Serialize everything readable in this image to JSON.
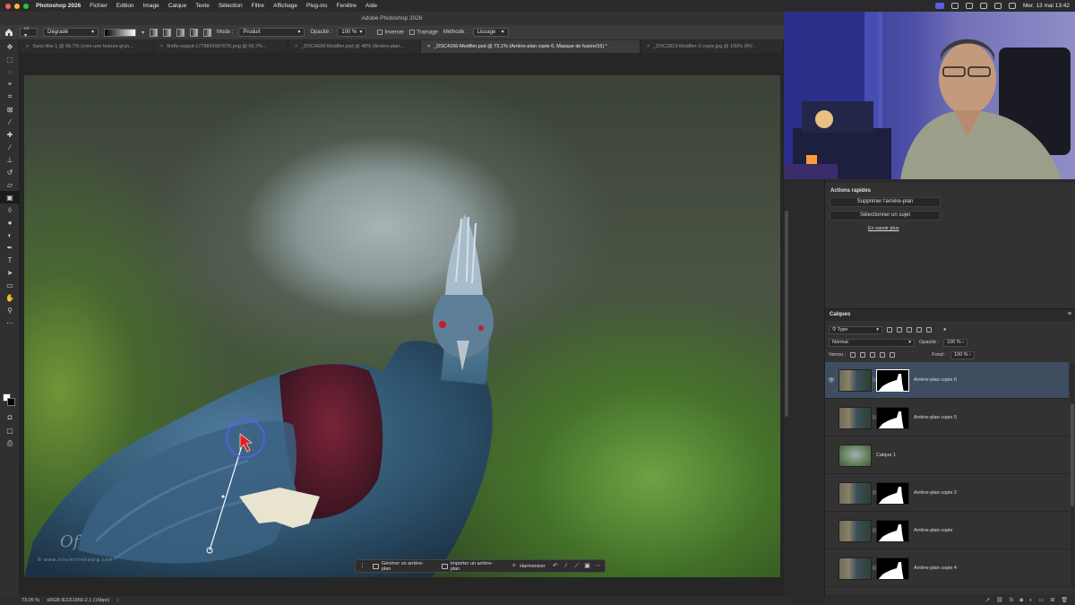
{
  "menubar": {
    "app": "Photoshop 2026",
    "items": [
      "Fichier",
      "Edition",
      "Image",
      "Calque",
      "Texte",
      "Sélection",
      "Filtre",
      "Affichage",
      "Plug-ins",
      "Fenêtre",
      "Aide"
    ],
    "datetime": "Mer. 13 mai 13:42"
  },
  "window_title": "Adobe Photoshop 2026",
  "options": {
    "preset": "Dégradé",
    "mode_label": "Mode :",
    "mode_value": "Produit",
    "opacity_label": "Opacité :",
    "opacity_value": "100 %",
    "invert": "Inverser",
    "dither": "Tramage",
    "method_label": "Méthode :",
    "method_value": "Lissage"
  },
  "tabs": [
    "Sans titre-1 @ 66,7% (crée une texture grun...",
    "firefly-output-1778664997676.png @ 66,7%...",
    "_DSC4690-Modifier.psd @ 48% (Arrière-plan...",
    "_DSC4166-Modifier.psd @ 73,1% (Arrière-plan copie 6, Masque de fusion/16) *",
    "_DSC2813-Modifier-2-copie.jpg @ 100% (RV..."
  ],
  "canvas": {
    "watermark": "© www.olivierfrebourg.com",
    "signature": "Of"
  },
  "contextual_bar": {
    "generate_bg": "Générer un arrière-plan",
    "import_bg": "Importer un arrière-plan",
    "harmonize": "Harmoniser"
  },
  "status": {
    "zoom": "73,05 %",
    "profile": "sRGB IEC61966-2.1 (16bpc)",
    "arrow": "›"
  },
  "quick_actions": {
    "title": "Actions rapides",
    "remove_bg": "Supprimer l'arrière-plan",
    "select_subject": "Sélectionner un sujet",
    "learn_more": "En savoir plus"
  },
  "layers_panel": {
    "title": "Calques",
    "filter": "Type",
    "blend_mode": "Normal",
    "opacity_label": "Opacité :",
    "opacity_value": "100 %",
    "lock_label": "Verrou :",
    "fill_label": "Fond :",
    "fill_value": "100 %",
    "layers": [
      {
        "name": "Arrière-plan copie 6",
        "selected": true,
        "visible": true,
        "mask": true
      },
      {
        "name": "Arrière-plan copie 5",
        "selected": false,
        "visible": false,
        "mask": true
      },
      {
        "name": "Calque 1",
        "selected": false,
        "visible": false,
        "mask": false
      },
      {
        "name": "Arrière-plan copie 2",
        "selected": false,
        "visible": false,
        "mask": true
      },
      {
        "name": "Arrière-plan copie",
        "selected": false,
        "visible": false,
        "mask": true
      },
      {
        "name": "Arrière-plan copie 4",
        "selected": false,
        "visible": false,
        "mask": true
      }
    ]
  },
  "colors": {
    "menubar": "#2a2a2c",
    "panel": "#323232",
    "selected_layer": "#3e4d60",
    "brush_ring": "#5b5bff",
    "cursor": "#e02020"
  }
}
